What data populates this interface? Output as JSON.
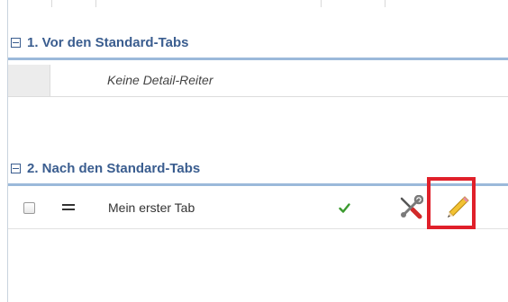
{
  "sections": [
    {
      "title": "1. Vor den Standard-Tabs",
      "empty_message": "Keine Detail-Reiter"
    },
    {
      "title": "2. Nach den Standard-Tabs",
      "rows": [
        {
          "label": "Mein erster Tab",
          "active": true
        }
      ]
    }
  ],
  "colors": {
    "section_title": "#3a5d8f",
    "section_border": "#9bb9da",
    "highlight": "#e0202a",
    "check": "#3b9a2f"
  },
  "icons": [
    "collapse-icon",
    "drag-handle-icon",
    "checkmark-icon",
    "tools-icon",
    "pencil-icon"
  ]
}
